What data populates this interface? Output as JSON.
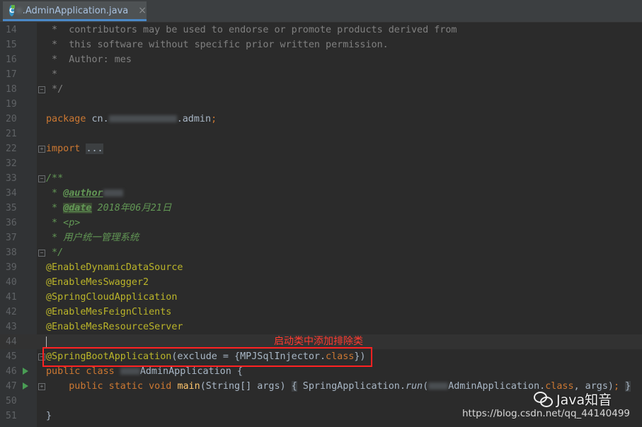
{
  "tab": {
    "icon": "java-class-icon",
    "name": ".AdminApplication.java",
    "close": "×"
  },
  "lines": [
    {
      "n": "14",
      "fold": "",
      "run": false,
      "tokens": [
        [
          "cm",
          " *  contributors may be used to endorse or promote products derived from"
        ]
      ]
    },
    {
      "n": "15",
      "fold": "",
      "run": false,
      "tokens": [
        [
          "cm",
          " *  this software without specific prior written permission."
        ]
      ]
    },
    {
      "n": "16",
      "fold": "",
      "run": false,
      "tokens": [
        [
          "cm",
          " *  Author: mes"
        ]
      ]
    },
    {
      "n": "17",
      "fold": "",
      "run": false,
      "tokens": [
        [
          "cm",
          " *"
        ]
      ]
    },
    {
      "n": "18",
      "fold": "-",
      "run": false,
      "tokens": [
        [
          "cm",
          " */"
        ]
      ]
    },
    {
      "n": "19",
      "fold": "",
      "run": false,
      "tokens": []
    },
    {
      "n": "20",
      "fold": "",
      "run": false,
      "tokens": [
        [
          "kw",
          "package "
        ],
        [
          "",
          "cn."
        ],
        [
          "blurwide",
          ""
        ],
        [
          "",
          ".admin"
        ],
        [
          "kw",
          ";"
        ]
      ]
    },
    {
      "n": "21",
      "fold": "",
      "run": false,
      "tokens": []
    },
    {
      "n": "22",
      "fold": "+",
      "run": false,
      "tokens": [
        [
          "kw",
          "import "
        ],
        [
          "fold-text",
          "..."
        ]
      ]
    },
    {
      "n": "32",
      "fold": "",
      "run": false,
      "tokens": []
    },
    {
      "n": "33",
      "fold": "-",
      "run": false,
      "tokens": [
        [
          "doc",
          "/**"
        ]
      ]
    },
    {
      "n": "34",
      "fold": "",
      "run": false,
      "tokens": [
        [
          "doc",
          " * "
        ],
        [
          "dtag",
          "@author"
        ],
        [
          "blur",
          ""
        ]
      ]
    },
    {
      "n": "35",
      "fold": "",
      "run": false,
      "tokens": [
        [
          "doc",
          " * "
        ],
        [
          "dtag hl",
          "@date"
        ],
        [
          "doc",
          " 2018年06月21日"
        ]
      ]
    },
    {
      "n": "36",
      "fold": "",
      "run": false,
      "tokens": [
        [
          "doc",
          " * <p>"
        ]
      ]
    },
    {
      "n": "37",
      "fold": "",
      "run": false,
      "tokens": [
        [
          "doc",
          " * 用户统一管理系统"
        ]
      ]
    },
    {
      "n": "38",
      "fold": "-",
      "run": false,
      "tokens": [
        [
          "doc",
          " */"
        ]
      ]
    },
    {
      "n": "39",
      "fold": "",
      "run": false,
      "tokens": [
        [
          "ann",
          "@EnableDynamicDataSource"
        ]
      ]
    },
    {
      "n": "40",
      "fold": "",
      "run": false,
      "tokens": [
        [
          "ann",
          "@EnableMesSwagger2"
        ]
      ]
    },
    {
      "n": "41",
      "fold": "",
      "run": false,
      "tokens": [
        [
          "ann",
          "@SpringCloudApplication"
        ]
      ]
    },
    {
      "n": "42",
      "fold": "",
      "run": false,
      "tokens": [
        [
          "ann",
          "@EnableMesFeignClients"
        ]
      ]
    },
    {
      "n": "43",
      "fold": "",
      "run": false,
      "tokens": [
        [
          "ann",
          "@EnableMesResourceServer"
        ]
      ]
    },
    {
      "n": "44",
      "fold": "",
      "run": false,
      "current": true,
      "tokens": [
        [
          "cursor",
          ""
        ]
      ]
    },
    {
      "n": "45",
      "fold": "-",
      "run": false,
      "tokens": [
        [
          "ann",
          "@SpringBootApplication"
        ],
        [
          "",
          "(exclude = {MPJSqlInjector."
        ],
        [
          "kw",
          "class"
        ],
        [
          "",
          "})"
        ]
      ]
    },
    {
      "n": "46",
      "fold": "",
      "run": true,
      "tokens": [
        [
          "kw",
          "public class "
        ],
        [
          "blur",
          ""
        ],
        [
          "",
          "AdminApplication {"
        ]
      ]
    },
    {
      "n": "47",
      "fold": "+",
      "run": true,
      "tokens": [
        [
          "",
          "    "
        ],
        [
          "kw",
          "public static void "
        ],
        [
          "fn",
          "main"
        ],
        [
          "",
          "(String[] args) "
        ],
        [
          "fold-text",
          "{"
        ],
        [
          "",
          " SpringApplication."
        ],
        [
          "it",
          "run"
        ],
        [
          "",
          "("
        ],
        [
          "blur",
          ""
        ],
        [
          "",
          "AdminApplication."
        ],
        [
          "kw",
          "class"
        ],
        [
          "",
          ", args)"
        ],
        [
          "kw",
          ";"
        ],
        [
          "",
          " "
        ],
        [
          "fold-text",
          "}"
        ]
      ]
    },
    {
      "n": "50",
      "fold": "",
      "run": false,
      "tokens": []
    },
    {
      "n": "51",
      "fold": "",
      "run": false,
      "tokens": [
        [
          "",
          "}"
        ]
      ]
    }
  ],
  "annotation_note": "启动类中添加排除类",
  "watermark": {
    "brand": "Java知音",
    "url": "https://blog.csdn.net/qq_44140499"
  },
  "colors": {
    "background": "#2b2b2b",
    "keyword": "#cc7832",
    "annotation": "#bbb529",
    "comment": "#808080",
    "doc": "#629755",
    "highlight_box": "#ff2222"
  }
}
